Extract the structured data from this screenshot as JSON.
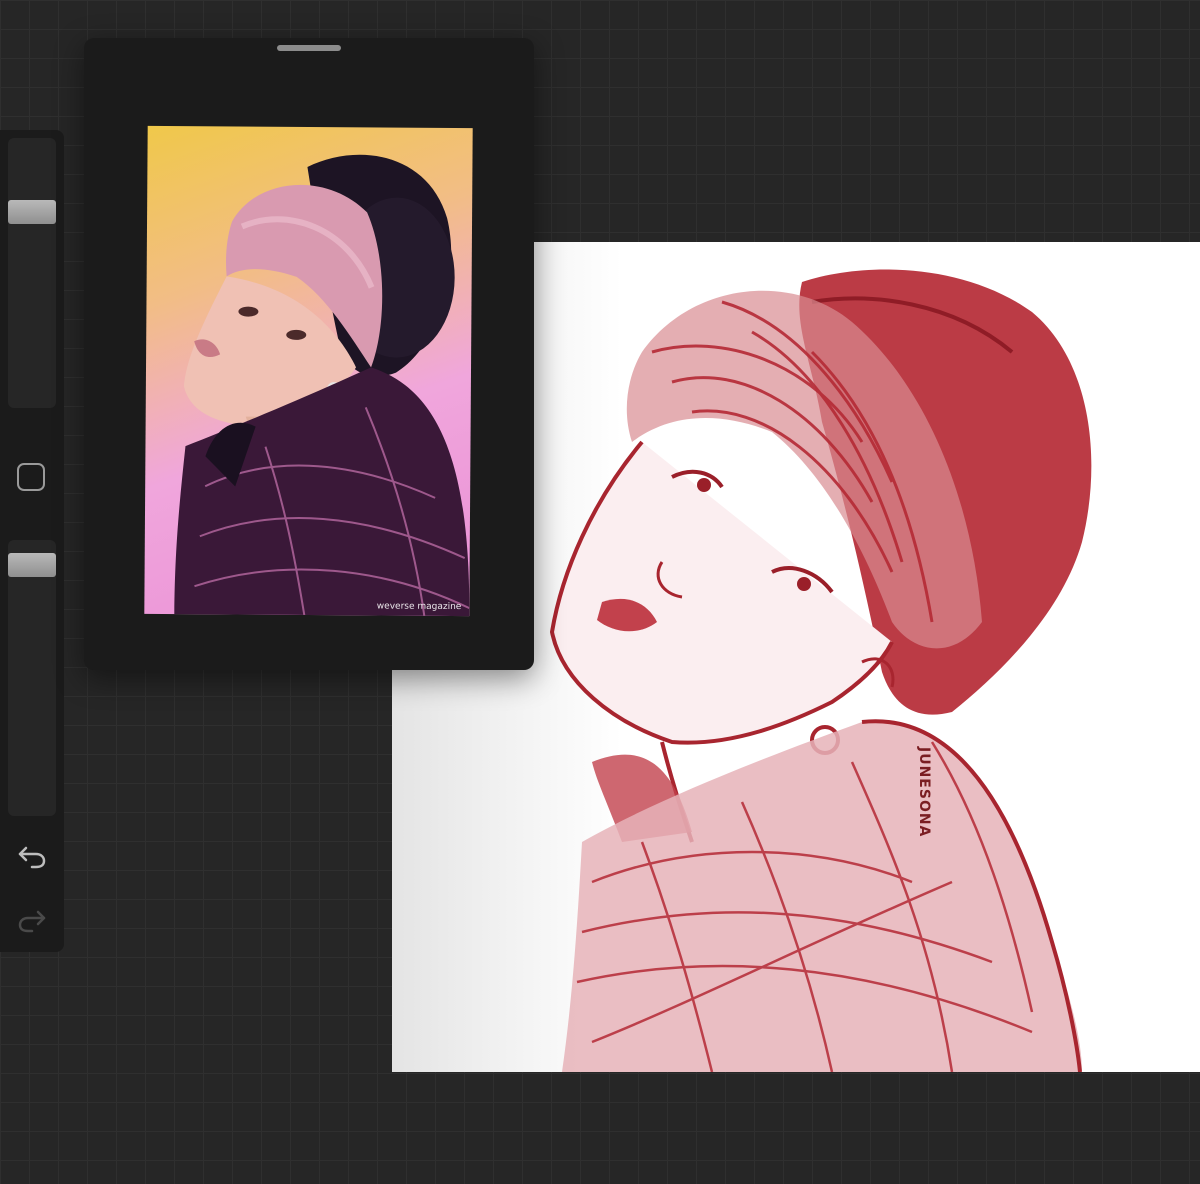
{
  "canvas": {
    "signature": "JUNESONA"
  },
  "reference": {
    "watermark": "weverse magazine"
  },
  "icons": {
    "modify": "square-icon",
    "undo": "undo-icon",
    "redo": "redo-icon"
  },
  "colors": {
    "background": "#262626",
    "sidebar": "#1b1b1b",
    "sketch_ink": "#b52a35",
    "canvas": "#ffffff"
  },
  "sidebar": {
    "brush_size_level": 0.75,
    "opacity_level": 0.95
  }
}
